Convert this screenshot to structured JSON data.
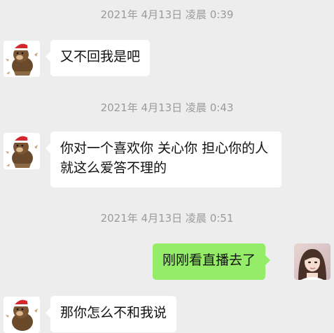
{
  "messages": [
    {
      "timestamp": "2021年 4月13日 凌晨 0:39",
      "sender": "other",
      "avatar_icon": "brown-bear-santa-hat-avatar",
      "text": "又不回我是吧"
    },
    {
      "timestamp": "2021年 4月13日 凌晨 0:43",
      "sender": "other",
      "avatar_icon": "brown-bear-santa-hat-avatar",
      "text": "你对一个喜欢你 关心你 担心你的人就这么爱答不理的"
    },
    {
      "timestamp": "2021年 4月13日 凌晨 0:51",
      "sender": "me",
      "avatar_icon": "girl-portrait-avatar",
      "text": "刚刚看直播去了"
    },
    {
      "sender": "other",
      "avatar_icon": "brown-bear-santa-hat-avatar",
      "text": "那你怎么不和我说"
    }
  ],
  "colors": {
    "background": "#ededed",
    "incoming_bubble": "#ffffff",
    "outgoing_bubble": "#95ec69",
    "timestamp_text": "#9a9a9a"
  }
}
